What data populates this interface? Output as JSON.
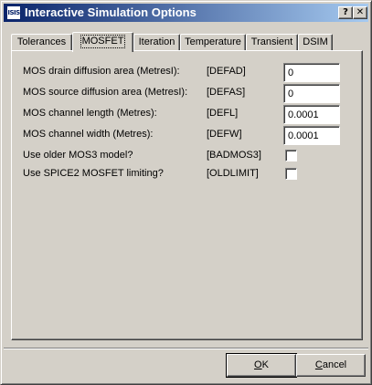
{
  "window": {
    "title": "Interactive Simulation Options",
    "app_icon_text": "ISIS",
    "help_glyph": "?",
    "close_glyph": "✕"
  },
  "tabs": [
    {
      "label": "Tolerances"
    },
    {
      "label": "MOSFET",
      "active": true
    },
    {
      "label": "Iteration"
    },
    {
      "label": "Temperature"
    },
    {
      "label": "Transient"
    },
    {
      "label": "DSIM"
    }
  ],
  "fields": [
    {
      "label": "MOS drain diffusion area (MetresI):",
      "key": "[DEFAD]",
      "value": "0"
    },
    {
      "label": "MOS source diffusion area (MetresI):",
      "key": "[DEFAS]",
      "value": "0"
    },
    {
      "label": "MOS channel length (Metres):",
      "key": "[DEFL]",
      "value": "0.0001"
    },
    {
      "label": "MOS channel width (Metres):",
      "key": "[DEFW]",
      "value": "0.0001"
    }
  ],
  "checks": [
    {
      "label": "Use older MOS3 model?",
      "key": "[BADMOS3]",
      "checked": false
    },
    {
      "label": "Use SPICE2 MOSFET limiting?",
      "key": "[OLDLIMIT]",
      "checked": false
    }
  ],
  "buttons": {
    "ok_accel": "O",
    "ok_rest": "K",
    "cancel_accel": "C",
    "cancel_rest": "ancel"
  }
}
